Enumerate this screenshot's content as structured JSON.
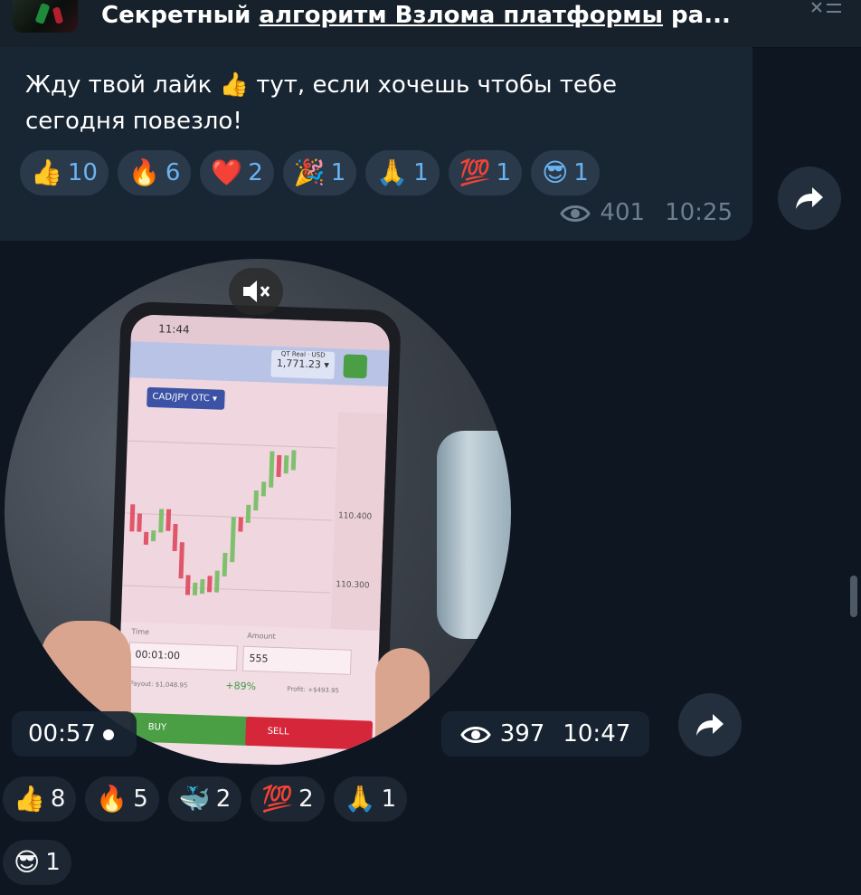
{
  "header": {
    "title_prefix": "Секретный ",
    "title_link": "алгоритм Взлома платформы",
    "title_suffix": " ра..."
  },
  "message1": {
    "text_before_emoji": "Жду твой лайк ",
    "text_emoji": "👍",
    "text_after_emoji": " тут, если хочешь чтобы тебе сегодня повезло!",
    "reactions": [
      {
        "emoji": "👍",
        "count": "10"
      },
      {
        "emoji": "🔥",
        "count": "6"
      },
      {
        "emoji": "❤️",
        "count": "2"
      },
      {
        "emoji": "🎉",
        "count": "1"
      },
      {
        "emoji": "🙏",
        "count": "1"
      },
      {
        "emoji": "💯",
        "count": "1"
      },
      {
        "emoji": "😎",
        "count": "1"
      }
    ],
    "views": "401",
    "time": "10:25"
  },
  "message2": {
    "phone_screen": {
      "clock": "11:44",
      "pair": "CAD/JPY OTC ▾",
      "balance_label": "QT Real · USD",
      "balance": "1,771.23 ▾",
      "time_label": "Time",
      "time_value": "00:01:00",
      "amount_label": "Amount",
      "amount_value": "555",
      "payout": "Payout: $1,048.95",
      "percent": "+89%",
      "profit": "Profit: +$493.95",
      "buy": "BUY",
      "sell": "SELL",
      "prices": [
        "110.400",
        "110.300"
      ]
    },
    "duration": "00:57",
    "views": "397",
    "time": "10:47",
    "reactions": [
      {
        "emoji": "👍",
        "count": "8"
      },
      {
        "emoji": "🔥",
        "count": "5"
      },
      {
        "emoji": "🐳",
        "count": "2"
      },
      {
        "emoji": "💯",
        "count": "2"
      },
      {
        "emoji": "🙏",
        "count": "1"
      },
      {
        "emoji": "😎",
        "count": "1"
      }
    ]
  },
  "colors": {
    "background": "#0e1621",
    "bubble": "#182533",
    "accent": "#6ab3f3",
    "meta": "#6d7f8f"
  },
  "icons": [
    "eye-icon",
    "forward-icon",
    "mute-icon"
  ]
}
